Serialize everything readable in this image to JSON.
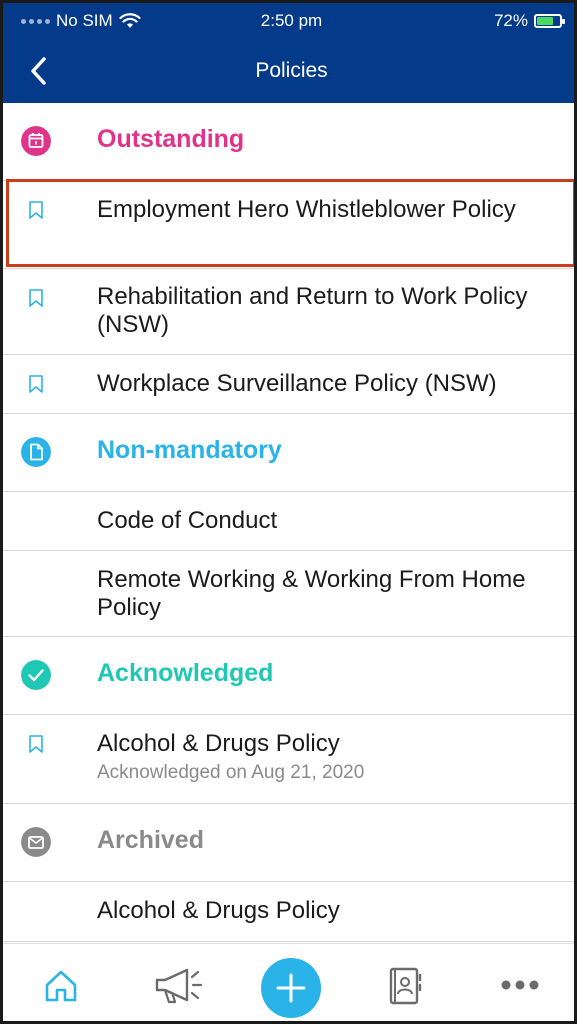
{
  "status_bar": {
    "carrier": "No SIM",
    "time": "2:50 pm",
    "battery": "72%",
    "battery_level": 0.72
  },
  "nav": {
    "title": "Policies"
  },
  "sections": {
    "outstanding": {
      "label": "Outstanding",
      "color": "#e0348a",
      "items": [
        {
          "title": "Employment Hero Whistleblower Policy"
        },
        {
          "title": "Rehabilitation and Return to Work Policy (NSW)"
        },
        {
          "title": "Workplace Surveillance Policy (NSW)"
        }
      ]
    },
    "non_mandatory": {
      "label": "Non-mandatory",
      "color": "#29b3e8",
      "items": [
        {
          "title": "Code of Conduct"
        },
        {
          "title": "Remote Working & Working From Home Policy"
        }
      ]
    },
    "acknowledged": {
      "label": "Acknowledged",
      "color": "#1fc8b4",
      "items": [
        {
          "title": "Alcohol & Drugs Policy",
          "subtitle": "Acknowledged on Aug 21, 2020"
        }
      ]
    },
    "archived": {
      "label": "Archived",
      "color": "#8a8a8a",
      "items": [
        {
          "title": "Alcohol & Drugs Policy"
        }
      ]
    }
  },
  "tabbar": {
    "icons": [
      "home-icon",
      "megaphone-icon",
      "plus-icon",
      "contacts-book-icon",
      "more-icon"
    ],
    "active_color": "#29b3e8",
    "inactive_color": "#6b6b6b"
  }
}
